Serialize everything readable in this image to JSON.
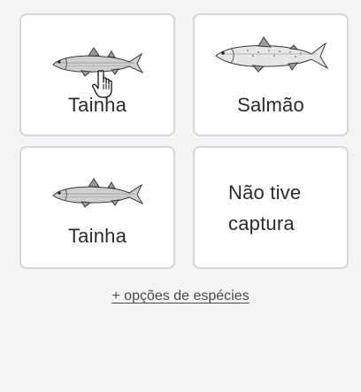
{
  "cards": [
    {
      "label": "Tainha",
      "icon": "mullet-fish-icon"
    },
    {
      "label": "Salmão",
      "icon": "salmon-fish-icon"
    },
    {
      "label": "Tainha",
      "icon": "mullet-fish-icon"
    },
    {
      "label_line1": "Não tive",
      "label_line2": "captura"
    }
  ],
  "more_species_link": "+ opções de espécies",
  "colors": {
    "background": "#f3f4f6",
    "card_border": "#d4d6da",
    "text": "#2b2b2b"
  }
}
